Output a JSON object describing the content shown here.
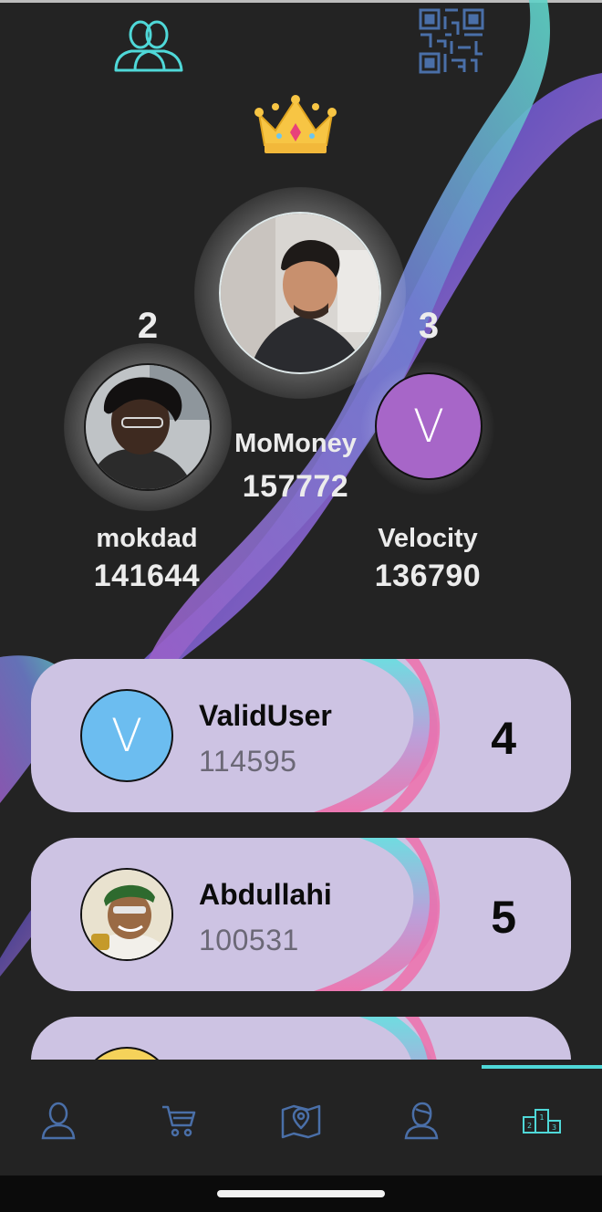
{
  "header": {
    "friends_icon": "friends-group-icon",
    "qr_icon": "qr-code-icon",
    "crown_icon": "crown-icon"
  },
  "podium": {
    "first": {
      "name": "MoMoney",
      "score": "157772"
    },
    "second": {
      "rank": "2",
      "name": "mokdad",
      "score": "141644"
    },
    "third": {
      "rank": "3",
      "name": "Velocity",
      "score": "136790",
      "avatar_letter": "V",
      "avatar_color": "#a766c8"
    }
  },
  "leaderboard": [
    {
      "name": "ValidUser",
      "score": "114595",
      "rank": "4",
      "avatar_letter": "V",
      "avatar_color": "#6cbdf0"
    },
    {
      "name": "Abdullahi",
      "score": "100531",
      "rank": "5"
    },
    {
      "avatar_color": "#f5d25a"
    }
  ],
  "tabbar": {
    "tabs": [
      {
        "icon": "person-icon"
      },
      {
        "icon": "cart-icon"
      },
      {
        "icon": "map-pin-icon"
      },
      {
        "icon": "profile-icon"
      },
      {
        "icon": "podium-icon",
        "active": true
      }
    ]
  },
  "colors": {
    "background": "#232323",
    "card": "#cdc3e3",
    "accent": "#4fd8d8",
    "icon_blue": "#4a6fa8"
  }
}
